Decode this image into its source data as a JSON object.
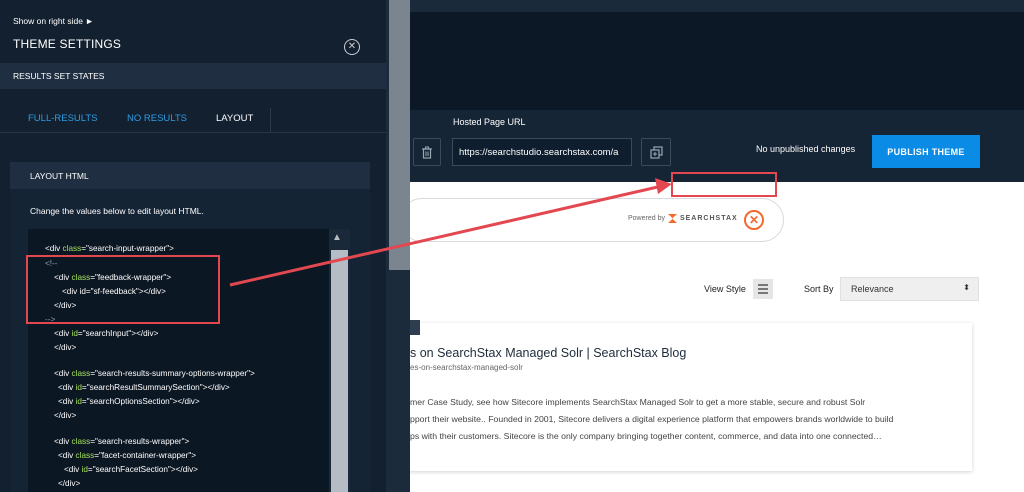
{
  "left_panel": {
    "show_right_label": "Show on right side ►",
    "title": "THEME SETTINGS",
    "close_glyph": "✕",
    "results_set_states_label": "RESULTS SET STATES",
    "tabs": [
      {
        "label": "FULL-RESULTS"
      },
      {
        "label": "NO RESULTS"
      },
      {
        "label": "LAYOUT"
      }
    ],
    "layout_html_label": "LAYOUT HTML",
    "change_values_text": "Change the values below to edit layout HTML.",
    "scroll_up_glyph": "▲",
    "code": {
      "l1_pre": "<div ",
      "l1_kw": "class",
      "l1_post": "=\"search-input-wrapper\">",
      "l2": "<!--",
      "l3_pre": "<div ",
      "l3_kw": "class",
      "l3_post": "=\"feedback-wrapper\">",
      "l4": "<div id=\"sf-feedback\"></div>",
      "l5": "</div>",
      "l6": "-->",
      "l7_pre": "<div ",
      "l7_kw": "id",
      "l7_post": "=\"searchInput\"></div>",
      "l8": "</div>",
      "l9_pre": "<div ",
      "l9_kw": "class",
      "l9_post": "=\"search-results-summary-options-wrapper\">",
      "l10_pre": "<div ",
      "l10_kw": "id",
      "l10_post": "=\"searchResultSummarySection\"></div>",
      "l11_pre": "<div ",
      "l11_kw": "id",
      "l11_post": "=\"searchOptionsSection\"></div>",
      "l12": "</div>",
      "l13_pre": "<div ",
      "l13_kw": "class",
      "l13_post": "=\"search-results-wrapper\">",
      "l14_pre": "<div ",
      "l14_kw": "class",
      "l14_post": "=\"facet-container-wrapper\">",
      "l15_pre": "<div ",
      "l15_kw": "id",
      "l15_post": "=\"searchFacetSection\"></div>",
      "l16": "</div>"
    }
  },
  "toolbar": {
    "hosted_page_label": "Hosted Page URL",
    "hosted_url": "https://searchstudio.searchstax.com/a",
    "unpublished_text": "No unpublished changes",
    "publish_label": "PUBLISH THEME"
  },
  "preview": {
    "powered_by": "Powered by",
    "brand": "SEARCHSTAX",
    "search_close_glyph": "✕",
    "view_style_label": "View Style",
    "sort_by_label": "Sort By",
    "sort_value": "Relevance",
    "sort_arrow": "⬍",
    "result": {
      "title": "s on SearchStax Managed Solr | SearchStax Blog",
      "url": "es-on-searchstax-managed-solr",
      "desc_lines": [
        "mer Case Study, see how Sitecore implements SearchStax Managed Solr to get a more stable, secure and robust Solr",
        "pport their website.. Founded in 2001, Sitecore delivers a digital experience platform that empowers brands worldwide to build",
        "ps with their customers. Sitecore is the only company bringing together content, commerce, and data into one connected…"
      ]
    }
  },
  "colors": {
    "accent_blue": "#0a8be6",
    "tab_blue": "#2e9ce6",
    "highlight_red": "#e34850",
    "brand_orange": "#f26a2d",
    "code_keyword": "#a4e05a"
  }
}
